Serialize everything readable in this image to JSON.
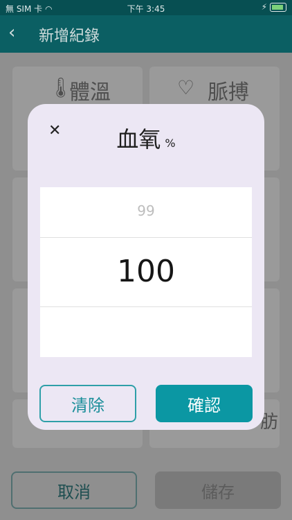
{
  "status_bar": {
    "carrier": "無 SIM 卡",
    "time": "下午 3:45"
  },
  "nav": {
    "title": "新增紀錄"
  },
  "background": {
    "tiles": [
      {
        "label": "體溫",
        "icon": "thermometer-icon"
      },
      {
        "label": "脈搏",
        "icon": "heart-pulse-icon"
      }
    ],
    "partial_label": "肪",
    "cancel_label": "取消",
    "save_label": "儲存"
  },
  "modal": {
    "title": "血氧",
    "unit": "%",
    "picker": {
      "above": "99",
      "selected": "100"
    },
    "clear_label": "清除",
    "confirm_label": "確認"
  }
}
